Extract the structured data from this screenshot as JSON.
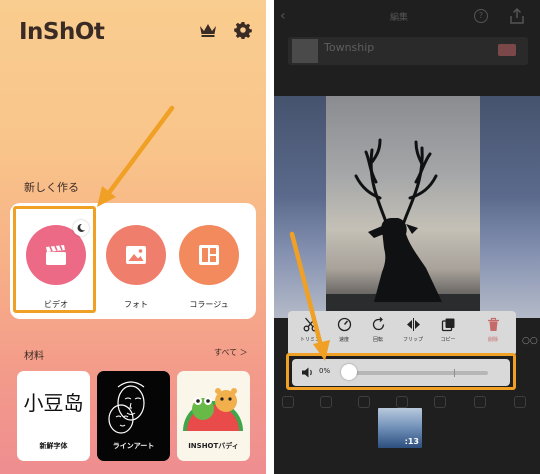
{
  "colors": {
    "accent_highlight": "#f0a024",
    "video_circle": "#ec6a86",
    "photo_circle": "#f07e6c",
    "collage_circle": "#f28a5e"
  },
  "home": {
    "logo": "InShOt",
    "crown_icon": "crown-icon",
    "settings_icon": "gear-icon",
    "new_section_title": "新しく作る",
    "tools": [
      {
        "label": "ビデオ",
        "icon": "clapperboard-icon",
        "highlighted": true
      },
      {
        "label": "フォト",
        "icon": "image-icon"
      },
      {
        "label": "コラージュ",
        "icon": "collage-icon"
      }
    ],
    "materials_title": "材料",
    "see_all": "すべて ＞",
    "materials": [
      {
        "label": "新鮮字体",
        "glyph": "小豆岛"
      },
      {
        "label": "ラインアート"
      },
      {
        "label": "INSHOTバディ"
      }
    ]
  },
  "editor": {
    "title": "編集",
    "music_track": "Township",
    "toolbar": [
      {
        "label": "トリミン",
        "icon": "scissors-icon"
      },
      {
        "label": "速度",
        "icon": "speedometer-icon"
      },
      {
        "label": "回転",
        "icon": "rotate-icon"
      },
      {
        "label": "フリップ",
        "icon": "flip-icon"
      },
      {
        "label": "コピー",
        "icon": "copy-icon"
      },
      {
        "label": "削除",
        "icon": "trash-icon"
      }
    ],
    "volume": {
      "label": "0%",
      "value": 0
    },
    "clip_duration": ":13"
  }
}
